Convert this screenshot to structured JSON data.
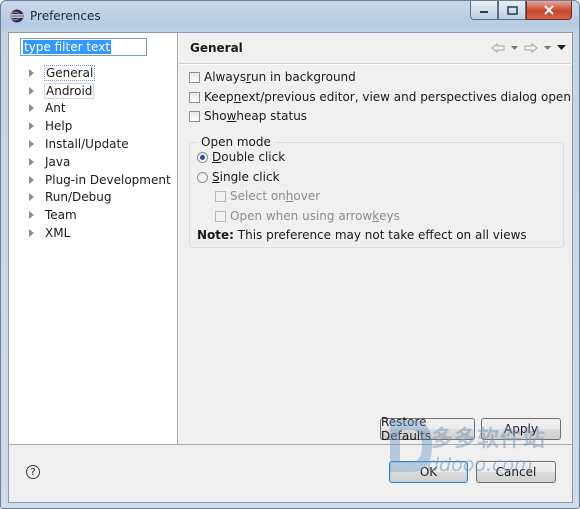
{
  "window": {
    "title": "Preferences"
  },
  "filter": {
    "text": "type filter text"
  },
  "tree": {
    "items": [
      {
        "label": "General",
        "selected": true
      },
      {
        "label": "Android",
        "selected": false
      },
      {
        "label": "Ant",
        "selected": false
      },
      {
        "label": "Help",
        "selected": false
      },
      {
        "label": "Install/Update",
        "selected": false
      },
      {
        "label": "Java",
        "selected": false
      },
      {
        "label": "Plug-in Development",
        "selected": false
      },
      {
        "label": "Run/Debug",
        "selected": false
      },
      {
        "label": "Team",
        "selected": false
      },
      {
        "label": "XML",
        "selected": false
      }
    ]
  },
  "page": {
    "title": "General",
    "always_run": {
      "pre": "Always ",
      "mn": "r",
      "post": "un in background",
      "checked": false
    },
    "keep_next": {
      "pre": "Keep ",
      "mn": "n",
      "post": "ext/previous editor, view and perspectives dialog open",
      "checked": false
    },
    "show_heap": {
      "pre": "Sho",
      "mn": "w",
      "post": " heap status",
      "checked": false
    },
    "open_mode": {
      "label": "Open mode",
      "double": {
        "mn": "D",
        "post": "ouble click",
        "selected": true
      },
      "single": {
        "mn": "S",
        "post": "ingle click",
        "selected": false
      },
      "select_hover": {
        "pre": "Select on ",
        "mn": "h",
        "post": "over",
        "enabled": false
      },
      "arrow_keys": {
        "pre": "Open when using arrow ",
        "mn": "k",
        "post": "eys",
        "enabled": false
      },
      "note_label": "Note:",
      "note_text": " This preference may not take effect on all views"
    }
  },
  "buttons": {
    "restore": "Restore Defaults",
    "apply": "Apply",
    "ok": "OK",
    "cancel": "Cancel"
  },
  "watermark": {
    "line1": "多多软件站",
    "line2": "ddooo.com"
  },
  "colors": {
    "selection": "#3399ff",
    "titlebar": "#b6cbe1",
    "close_button": "#c5452e"
  }
}
